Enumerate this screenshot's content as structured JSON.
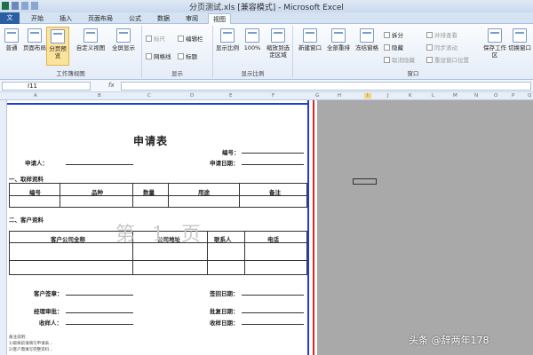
{
  "window": {
    "title": "分页测试.xls  [兼容模式] - Microsoft Excel"
  },
  "tabs": [
    "文件",
    "开始",
    "插入",
    "页面布局",
    "公式",
    "数据",
    "审阅",
    "视图"
  ],
  "ribbon": {
    "workbook_views": {
      "label": "工作簿视图",
      "buttons": [
        "普通",
        "页面布局",
        "分页预览",
        "自定义视图",
        "全屏显示"
      ]
    },
    "show": {
      "label": "显示",
      "items": [
        "标尺",
        "编辑栏",
        "网格线",
        "标题"
      ]
    },
    "zoom": {
      "label": "显示比例",
      "buttons": [
        "显示比例",
        "100%",
        "缩放到选定区域"
      ]
    },
    "window": {
      "label": "窗口",
      "buttons": [
        "新建窗口",
        "全部重排",
        "冻结窗格"
      ],
      "small": [
        "拆分",
        "隐藏",
        "取消隐藏",
        "并排查看",
        "同步滚动",
        "重设窗口位置"
      ],
      "save": "保存工作区",
      "switch": "切换窗口"
    }
  },
  "formula_bar": {
    "cell": "I11",
    "fx": "fx"
  },
  "columns": [
    "A",
    "B",
    "C",
    "D",
    "E",
    "F",
    "G",
    "H",
    "I",
    "J",
    "K",
    "L",
    "M",
    "N",
    "O",
    "P",
    "Q"
  ],
  "sheet": {
    "title": "申请表",
    "applicant": "申请人：",
    "number": "编号：",
    "apply_date": "申请日期：",
    "section1": "一、取样资料",
    "table1_headers": [
      "编号",
      "品种",
      "数量",
      "用途",
      "备注"
    ],
    "section2": "二、客户资料",
    "table2_headers": [
      "客户公司全称",
      "公司地址",
      "联系人",
      "电话"
    ],
    "customer_sign": "客户签章：",
    "sign_date": "签回日期：",
    "manager": "经理审批：",
    "approve_date": "批复日期：",
    "receiver": "收样人：",
    "receive_date": "收样日期：",
    "notes": [
      "备注说明：",
      "1)取样前请填写申请表...",
      "2)客户需填写完整资料..."
    ]
  },
  "watermark_page": "第 1 页",
  "corner_watermark": "头条 @辞两年178"
}
